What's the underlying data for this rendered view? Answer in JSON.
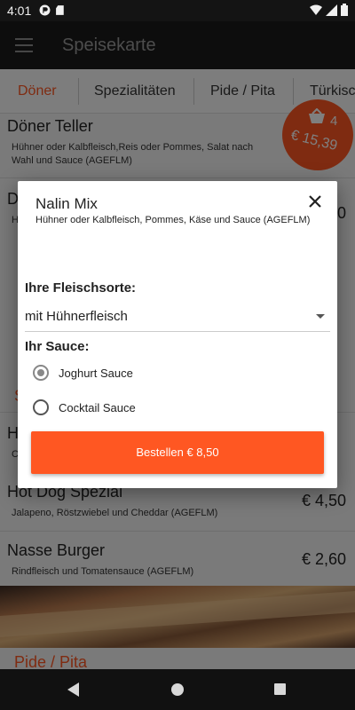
{
  "status_bar": {
    "time": "4:01"
  },
  "app_bar": {
    "title": "Speisekarte"
  },
  "tabs": [
    {
      "label": "Döner",
      "active": true
    },
    {
      "label": "Spezialitäten",
      "active": false
    },
    {
      "label": "Pide / Pita",
      "active": false
    },
    {
      "label": "Türkisc",
      "active": false
    }
  ],
  "menu_items": [
    {
      "name": "Döner Teller",
      "desc": "Hühner oder Kalbfleisch,Reis oder Pommes, Salat nach Wahl und Sauce (AGEFLM)",
      "price": ""
    },
    {
      "name": "D",
      "desc": "H",
      "price": "0"
    },
    {
      "name": "H",
      "desc": "C",
      "price": ""
    },
    {
      "name": "Hot Dog Spezial",
      "desc": "Jalapeno, Röstzwiebel und Cheddar (AGEFLM)",
      "price": "€ 4,50"
    },
    {
      "name": "Nasse Burger",
      "desc": "Rindfleisch und Tomatensauce (AGEFLM)",
      "price": "€ 2,60"
    }
  ],
  "sections": {
    "partial_s": "S",
    "pide": "Pide / Pita"
  },
  "cart": {
    "count": "4",
    "total": "€ 15,39"
  },
  "dialog": {
    "title": "Nalin Mix",
    "subtitle": "Hühner oder Kalbfleisch, Pommes, Käse und Sauce (AGEFLM)",
    "meat_label": "Ihre Fleischsorte:",
    "meat_selected": "mit Hühnerfleisch",
    "sauce_label": "Ihr Sauce:",
    "sauce_options": [
      {
        "label": "Joghurt Sauce",
        "selected": true
      },
      {
        "label": "Cocktail Sauce",
        "selected": false
      }
    ],
    "order_button": "Bestellen € 8,50"
  },
  "colors": {
    "accent": "#ff5722",
    "app_bar": "#1a1a1a"
  }
}
